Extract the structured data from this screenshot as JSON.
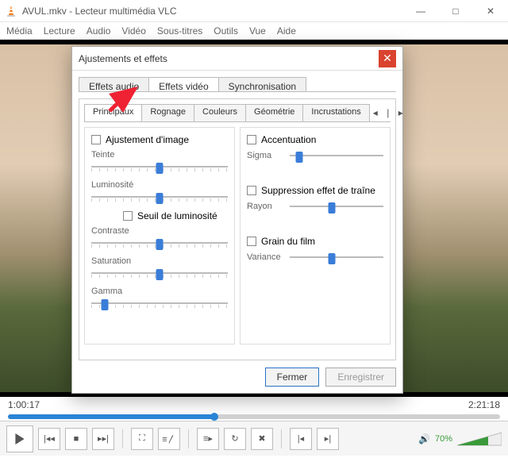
{
  "window": {
    "title": "AVUL.mkv - Lecteur multimédia VLC",
    "menu": [
      "Média",
      "Lecture",
      "Audio",
      "Vidéo",
      "Sous-titres",
      "Outils",
      "Vue",
      "Aide"
    ],
    "controls": {
      "min": "—",
      "max": "□",
      "close": "✕"
    }
  },
  "playback": {
    "elapsed": "1:00:17",
    "total": "2:21:18",
    "volume_percent": "70%"
  },
  "dialog": {
    "title": "Ajustements et effets",
    "close_glyph": "✕",
    "outer_tabs": [
      "Effets audio",
      "Effets vidéo",
      "Synchronisation"
    ],
    "outer_active_index": 1,
    "inner_tabs": [
      "Principaux",
      "Rognage",
      "Couleurs",
      "Géométrie",
      "Incrustations"
    ],
    "inner_active_index": 0,
    "footer": {
      "close": "Fermer",
      "save": "Enregistrer"
    },
    "left": {
      "image_adj": "Ajustement d'image",
      "teinte": "Teinte",
      "luminosite": "Luminosité",
      "seuil": "Seuil de luminosité",
      "contraste": "Contraste",
      "saturation": "Saturation",
      "gamma": "Gamma"
    },
    "right": {
      "accentuation": "Accentuation",
      "sigma": "Sigma",
      "suppression": "Suppression effet de traîne",
      "rayon": "Rayon",
      "grain": "Grain du film",
      "variance": "Variance"
    }
  }
}
